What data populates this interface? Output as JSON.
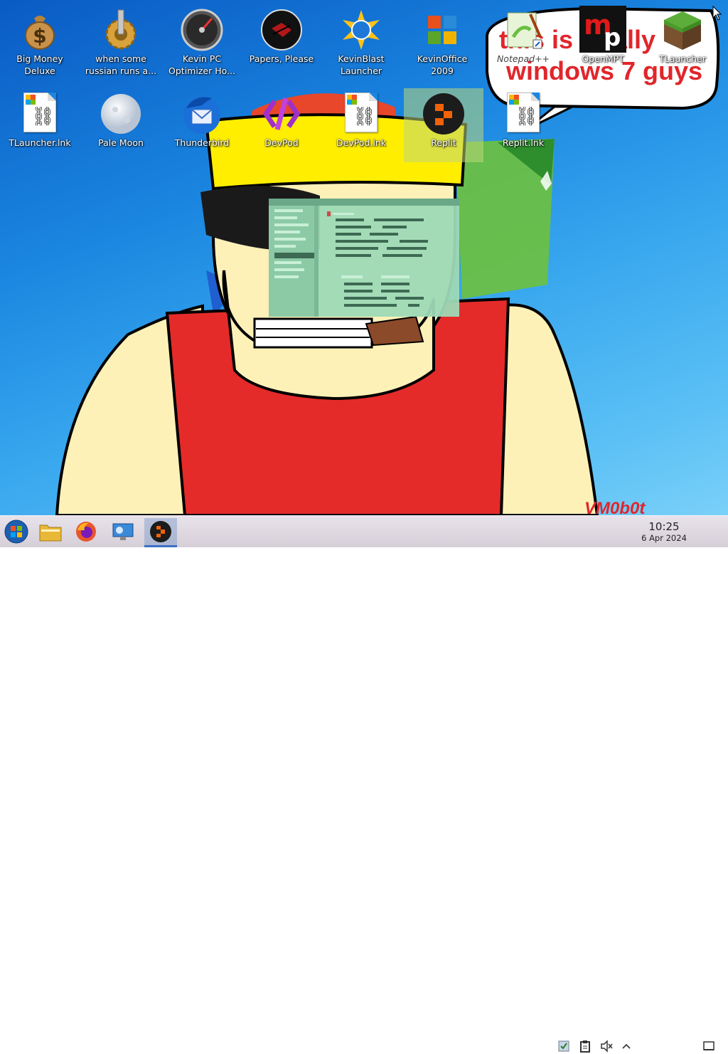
{
  "wallpaper": {
    "caption_lines": [
      "this is totally",
      "windows 7 guys"
    ],
    "signature": "VM0b0t"
  },
  "desktop_icons": [
    {
      "label": "Big Money\nDeluxe",
      "icon": "money-bag-icon"
    },
    {
      "label": "when some\nrussian runs a...",
      "icon": "gear-icon"
    },
    {
      "label": "Kevin PC\nOptimizer Ho...",
      "icon": "speedometer-icon"
    },
    {
      "label": "Papers, Please",
      "icon": "papers-please-icon"
    },
    {
      "label": "KevinBlast\nLauncher",
      "icon": "blast-launcher-icon"
    },
    {
      "label": "KevinOffice\n2009",
      "icon": "office-icon"
    },
    {
      "label": "Notepad++",
      "icon": "notepad-plus-plus-icon"
    },
    {
      "label": "OpenMPT",
      "icon": "openmpt-icon"
    },
    {
      "label": "TLauncher",
      "icon": "grass-block-icon"
    },
    {
      "label": "TLauncher.lnk",
      "icon": "shortcut-file-icon"
    },
    {
      "label": "Pale Moon",
      "icon": "moon-icon"
    },
    {
      "label": "Thunderbird",
      "icon": "thunderbird-icon"
    },
    {
      "label": "DevPod",
      "icon": "devpod-icon"
    },
    {
      "label": "DevPod.lnk",
      "icon": "shortcut-file-icon"
    },
    {
      "label": "Replit",
      "icon": "replit-icon"
    },
    {
      "label": "Replit.lnk",
      "icon": "shortcut-file-icon"
    }
  ],
  "taskbar": {
    "apps": [
      "start-orb-icon",
      "file-explorer-icon",
      "firefox-icon",
      "system-settings-icon",
      "replit-icon"
    ],
    "active_app": "replit-icon",
    "tray_icons": [
      "updates-icon",
      "clipboard-icon",
      "volume-muted-icon",
      "tray-expand-icon"
    ],
    "clock": {
      "time": "10:25",
      "date": "6 Apr 2024"
    },
    "show_desktop": "show-desktop-icon"
  },
  "colors": {
    "accent": "#3d6fc4",
    "shirt_red": "#e02a2a",
    "hair_yellow": "#ffee00",
    "skin": "#fdf1b8"
  }
}
